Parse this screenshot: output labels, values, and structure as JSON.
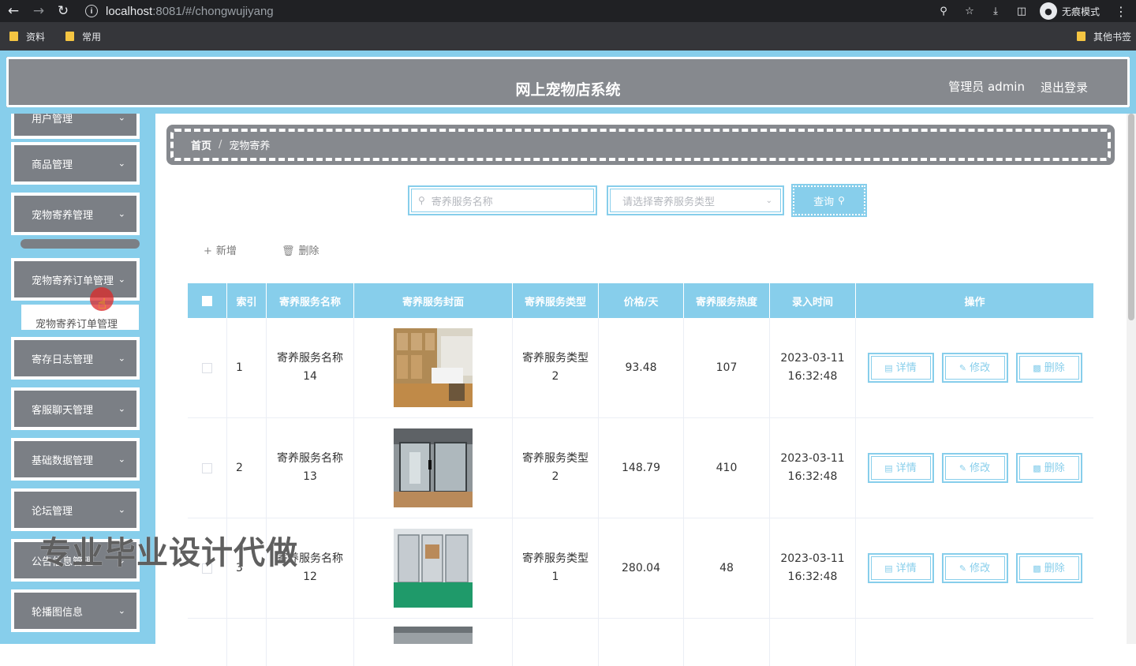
{
  "browser": {
    "url_host": "localhost",
    "url_path": ":8081/#/chongwujiyang",
    "incognito_label": "无痕模式",
    "bookmarks": [
      "资料",
      "常用"
    ],
    "other_bookmarks": "其他书签"
  },
  "header": {
    "title": "网上宠物店系统",
    "admin_label": "管理员 admin",
    "logout_label": "退出登录"
  },
  "sidebar": {
    "items": [
      {
        "label": "用户管理"
      },
      {
        "label": "商品管理"
      },
      {
        "label": "宠物寄养管理"
      },
      {
        "label": "宠物寄养订单管理"
      },
      {
        "label": "寄存日志管理"
      },
      {
        "label": "客服聊天管理"
      },
      {
        "label": "基础数据管理"
      },
      {
        "label": "论坛管理"
      },
      {
        "label": "公告信息管理"
      },
      {
        "label": "轮播图信息"
      }
    ],
    "submenu_item": "宠物寄养订单管理"
  },
  "breadcrumb": {
    "home": "首页",
    "current": "宠物寄养"
  },
  "search": {
    "name_placeholder": "寄养服务名称",
    "type_placeholder": "请选择寄养服务类型",
    "query_label": "查询"
  },
  "actions": {
    "add_label": "新增",
    "delete_label": "删除"
  },
  "table": {
    "columns": [
      "索引",
      "寄养服务名称",
      "寄养服务封面",
      "寄养服务类型",
      "价格/天",
      "寄养服务热度",
      "录入时间",
      "操作"
    ],
    "rows": [
      {
        "index": "1",
        "name_line1": "寄养服务名称",
        "name_line2": "14",
        "type_line1": "寄养服务类型",
        "type_line2": "2",
        "price": "93.48",
        "hot": "107",
        "date": "2023-03-11",
        "time": "16:32:48"
      },
      {
        "index": "2",
        "name_line1": "寄养服务名称",
        "name_line2": "13",
        "type_line1": "寄养服务类型",
        "type_line2": "2",
        "price": "148.79",
        "hot": "410",
        "date": "2023-03-11",
        "time": "16:32:48"
      },
      {
        "index": "3",
        "name_line1": "寄养服务名称",
        "name_line2": "12",
        "type_line1": "寄养服务类型",
        "type_line2": "1",
        "price": "280.04",
        "hot": "48",
        "date": "2023-03-11",
        "time": "16:32:48"
      }
    ],
    "op_labels": {
      "detail": "详情",
      "edit": "修改",
      "delete": "删除"
    }
  },
  "watermark": "专业毕业设计代做",
  "colors": {
    "accent": "#87ceeb",
    "header_bg": "#86898e",
    "menu_bg": "#7b7f85"
  }
}
